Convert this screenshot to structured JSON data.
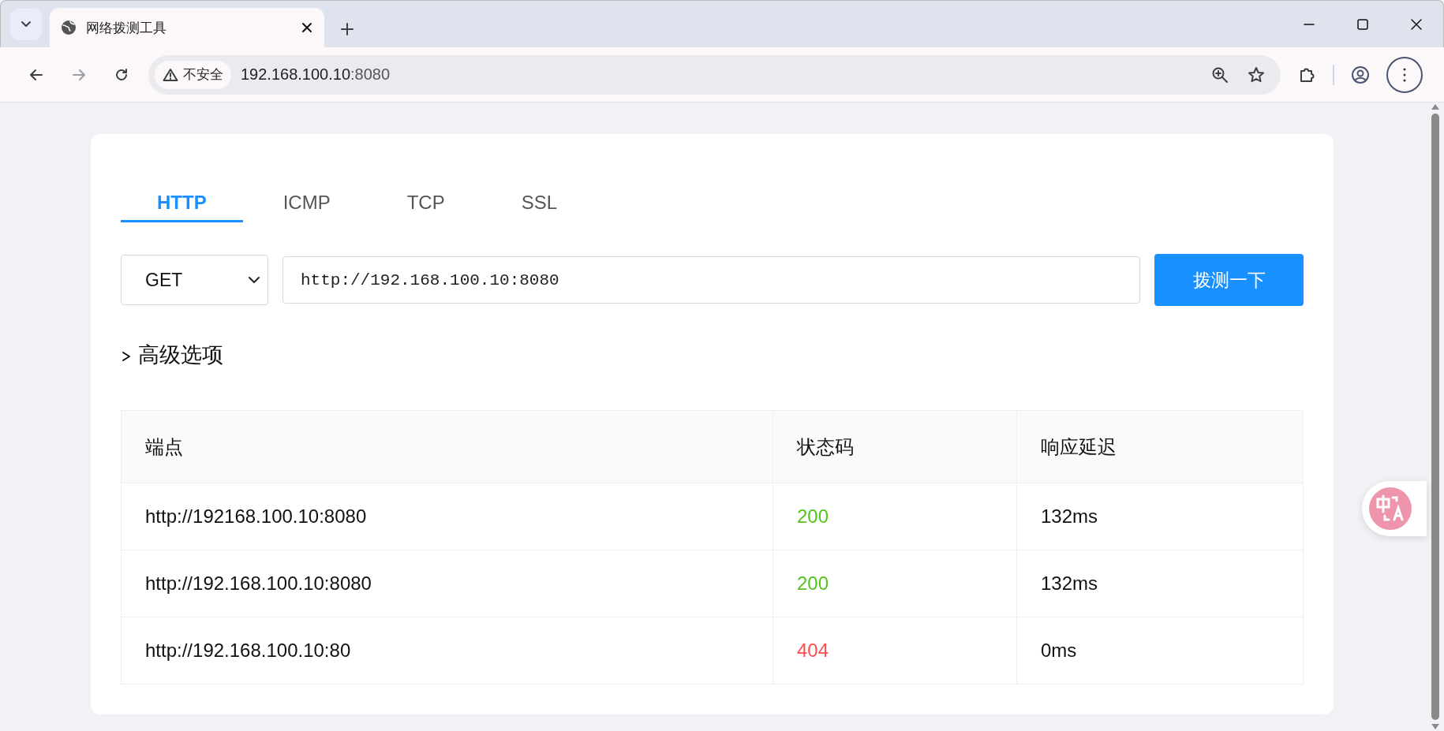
{
  "browser": {
    "tab_title": "网络拨测工具",
    "security_label": "不安全",
    "address_host": "192.168.100.10",
    "address_port": ":8080"
  },
  "tabs": [
    {
      "label": "HTTP",
      "selected": true
    },
    {
      "label": "ICMP",
      "selected": false
    },
    {
      "label": "TCP",
      "selected": false
    },
    {
      "label": "SSL",
      "selected": false
    }
  ],
  "method": "GET",
  "url": "http://192.168.100.10:8080",
  "probe_button": "拨测一下",
  "advanced_options": {
    "label": "高级选项",
    "expanded": false
  },
  "table": {
    "columns": [
      "端点",
      "状态码",
      "响应延迟"
    ],
    "rows": [
      {
        "endpoint": "http://192168.100.10:8080",
        "status": "200",
        "color": "#52c41a",
        "latency": "132ms"
      },
      {
        "endpoint": "http://192.168.100.10:8080",
        "status": "200",
        "color": "#52c41a",
        "latency": "132ms"
      },
      {
        "endpoint": "http://192.168.100.10:80",
        "status": "404",
        "color": "#ff4d4f",
        "latency": "0ms"
      }
    ]
  }
}
